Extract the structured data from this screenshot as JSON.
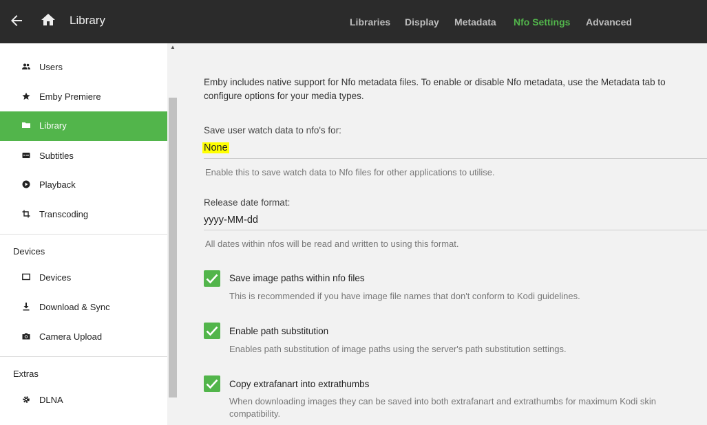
{
  "header": {
    "title": "Library",
    "tabs": [
      {
        "label": "Libraries",
        "active": false
      },
      {
        "label": "Display",
        "active": false
      },
      {
        "label": "Metadata",
        "active": false
      },
      {
        "label": "Nfo Settings",
        "active": true
      },
      {
        "label": "Advanced",
        "active": false
      }
    ]
  },
  "sidebar": {
    "items_top": [
      {
        "label": "Users",
        "icon": "users-icon"
      },
      {
        "label": "Emby Premiere",
        "icon": "star-icon"
      },
      {
        "label": "Library",
        "icon": "folder-icon",
        "active": true
      },
      {
        "label": "Subtitles",
        "icon": "subtitles-icon"
      },
      {
        "label": "Playback",
        "icon": "play-icon"
      },
      {
        "label": "Transcoding",
        "icon": "crop-icon"
      }
    ],
    "devices_heading": "Devices",
    "items_devices": [
      {
        "label": "Devices",
        "icon": "tablet-icon"
      },
      {
        "label": "Download & Sync",
        "icon": "download-icon"
      },
      {
        "label": "Camera Upload",
        "icon": "camera-icon"
      }
    ],
    "extras_heading": "Extras",
    "items_extras": [
      {
        "label": "DLNA",
        "icon": "gear-icon"
      }
    ]
  },
  "main": {
    "description": "Emby includes native support for Nfo metadata files. To enable or disable Nfo metadata, use the Metadata tab to configure options for your media types.",
    "watch_data": {
      "label": "Save user watch data to nfo's for:",
      "value": "None",
      "help": "Enable this to save watch data to Nfo files for other applications to utilise."
    },
    "release_date": {
      "label": "Release date format:",
      "value": "yyyy-MM-dd",
      "help": "All dates within nfos will be read and written to using this format."
    },
    "checkboxes": [
      {
        "label": "Save image paths within nfo files",
        "help": "This is recommended if you have image file names that don't conform to Kodi guidelines.",
        "checked": true
      },
      {
        "label": "Enable path substitution",
        "help": "Enables path substitution of image paths using the server's path substitution settings.",
        "checked": true
      },
      {
        "label": "Copy extrafanart into extrathumbs",
        "help": "When downloading images they can be saved into both extrafanart and extrathumbs for maximum Kodi skin compatibility.",
        "checked": true
      }
    ]
  },
  "colors": {
    "accent": "#52b54b",
    "header": "#2b2b2b",
    "highlight": "#ffff00"
  }
}
